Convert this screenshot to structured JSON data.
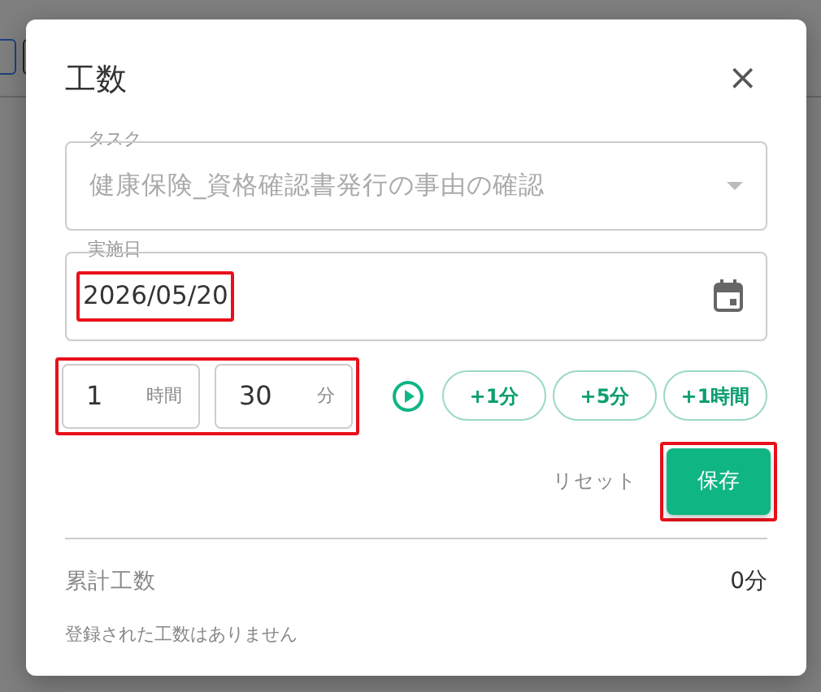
{
  "dialog": {
    "title": "工数",
    "close": "×",
    "task": {
      "label": "タスク",
      "value": "健康保険_資格確認書発行の事由の確認",
      "disabled": true
    },
    "date": {
      "label": "実施日",
      "value": "2026/05/20",
      "highlighted": true
    },
    "duration": {
      "highlighted": true,
      "fields": [
        {
          "value": "1",
          "unit": "時間"
        },
        {
          "value": "30",
          "unit": "分"
        }
      ]
    },
    "quick_add": [
      "+1分",
      "+5分",
      "+1時間"
    ],
    "actions": [
      {
        "label": "リセット",
        "kind": "text"
      },
      {
        "label": "保存",
        "kind": "primary",
        "highlighted": true
      }
    ],
    "total": {
      "label": "累計工数",
      "value": "0分"
    },
    "empty_message": "登録された工数はありません"
  }
}
